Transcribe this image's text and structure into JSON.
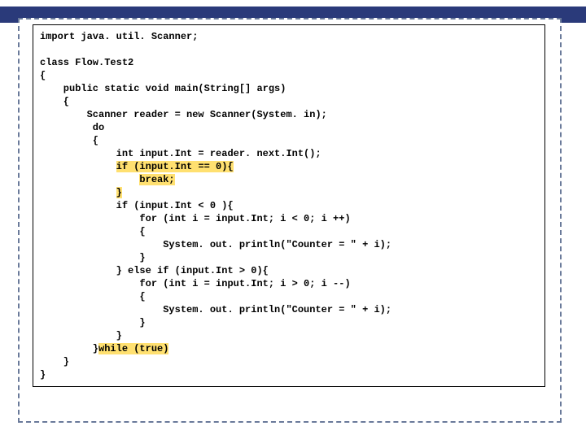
{
  "code": {
    "l01": "import java. util. Scanner;",
    "l02": "",
    "l03": "class Flow.Test2",
    "l04": "{",
    "l05": "    public static void main(String[] args)",
    "l06": "    {",
    "l07": "        Scanner reader = new Scanner(System. in);",
    "l08": "         do",
    "l09": "         {",
    "l10": "             int input.Int = reader. next.Int();",
    "l11a": "             ",
    "l11b": "if (input.Int == 0){",
    "l12a": "                 ",
    "l12b": "break;",
    "l13a": "             ",
    "l13b": "}",
    "l14": "             if (input.Int < 0 ){",
    "l15": "                 for (int i = input.Int; i < 0; i ++)",
    "l16": "                 {",
    "l17": "                     System. out. println(\"Counter = \" + i);",
    "l18": "                 }",
    "l19": "             } else if (input.Int > 0){",
    "l20": "                 for (int i = input.Int; i > 0; i --)",
    "l21": "                 {",
    "l22": "                     System. out. println(\"Counter = \" + i);",
    "l23": "                 }",
    "l24": "             }",
    "l25a": "         }",
    "l25b": "while (true)",
    "l26": "    }",
    "l27": "}"
  }
}
